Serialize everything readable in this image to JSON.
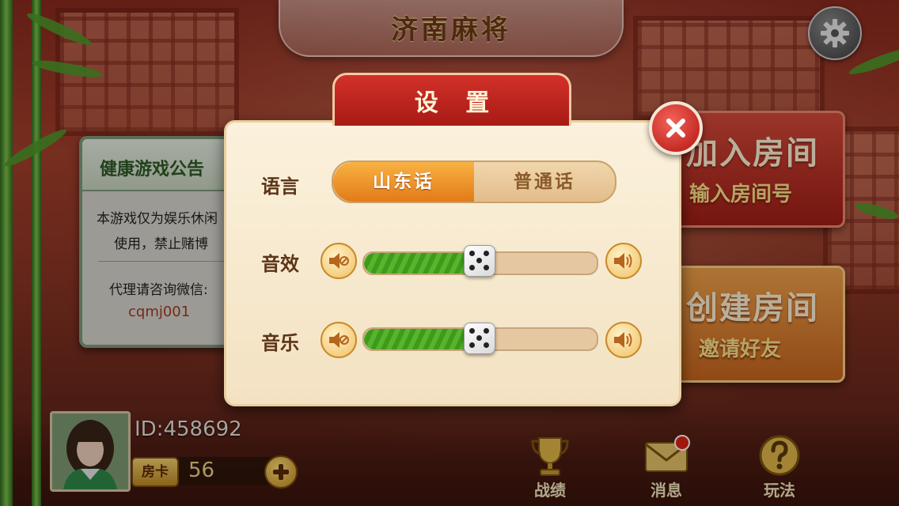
{
  "header": {
    "title": "济南麻将",
    "settings_icon": "gear-icon"
  },
  "notice": {
    "title": "健康游戏公告",
    "line1": "本游戏仅为娱乐休闲",
    "line2": "使用，禁止赌博",
    "contact_label": "代理请咨询微信:",
    "wechat": "cqmj001"
  },
  "actions": {
    "join": {
      "label": "加入房间",
      "sub": "输入房间号"
    },
    "create": {
      "label": "创建房间",
      "sub": "邀请好友"
    }
  },
  "player": {
    "id_text": "ID:458692",
    "card_label": "房卡",
    "card_count": "56"
  },
  "nav": {
    "record": "战绩",
    "message": "消息",
    "rules": "玩法"
  },
  "settings": {
    "title": "设 置",
    "language_label": "语言",
    "language_options": [
      "山东话",
      "普通话"
    ],
    "language_selected": "山东话",
    "sfx_label": "音效",
    "music_label": "音乐",
    "sfx_volume_percent": 50,
    "music_volume_percent": 50
  },
  "colors": {
    "accent_red": "#c2231c",
    "slider_green": "#4fae25",
    "panel_cream": "#fbf1dc"
  }
}
